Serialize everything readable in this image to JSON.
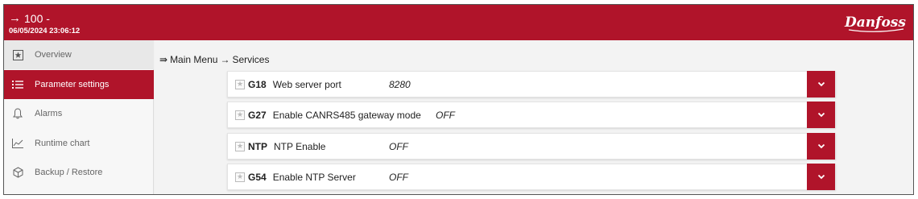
{
  "header": {
    "arrow": "→",
    "title": "100 -",
    "datetime": "06/05/2024 23:06:12",
    "logo_text": "Danfoss"
  },
  "sidebar": {
    "items": [
      {
        "label": "Overview",
        "icon": "star-box-icon"
      },
      {
        "label": "Parameter settings",
        "icon": "list-icon"
      },
      {
        "label": "Alarms",
        "icon": "bell-icon"
      },
      {
        "label": "Runtime chart",
        "icon": "chart-line-icon"
      },
      {
        "label": "Backup / Restore",
        "icon": "cube-icon"
      }
    ]
  },
  "breadcrumb": {
    "prefix": "⇛",
    "menu": "Main Menu",
    "sep": "→",
    "current": "Services"
  },
  "parameters": [
    {
      "code": "G18",
      "name": "Web server port",
      "value": "8280"
    },
    {
      "code": "G27",
      "name": "Enable CANRS485 gateway mode",
      "value": "OFF"
    },
    {
      "code": "NTP",
      "name": "NTP Enable",
      "value": "OFF"
    },
    {
      "code": "G54",
      "name": "Enable NTP Server",
      "value": "OFF"
    }
  ],
  "colors": {
    "accent": "#b0142a",
    "background": "#f3f3f3"
  }
}
